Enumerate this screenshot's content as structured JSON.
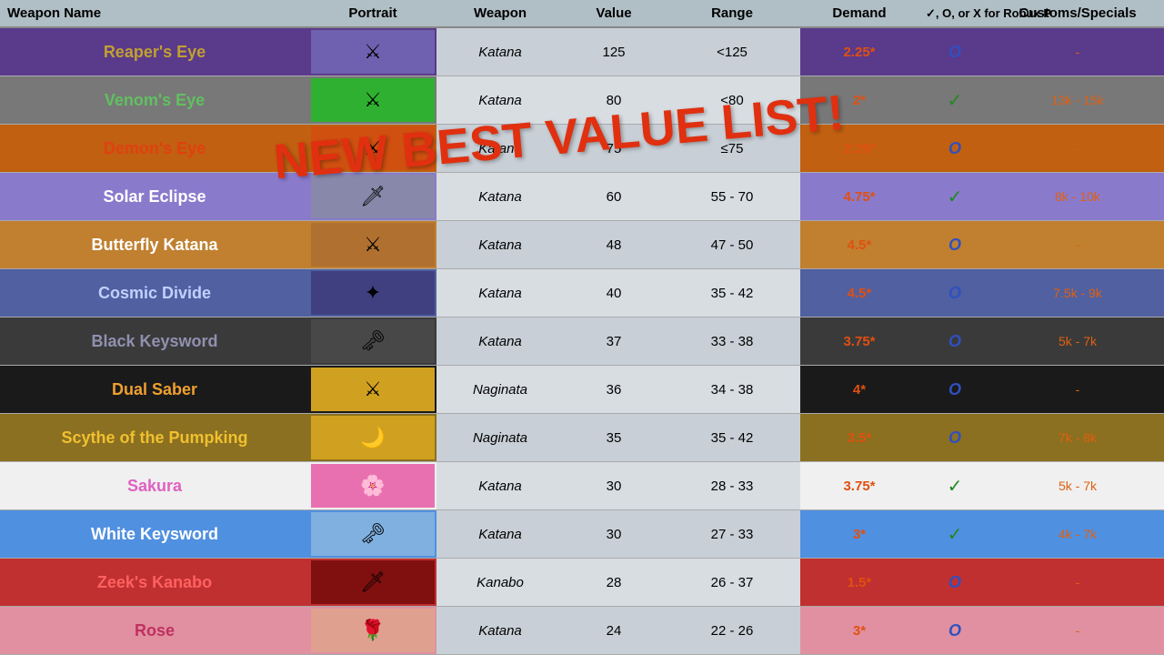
{
  "header": {
    "col_name": "Weapon Name",
    "col_portrait": "Portrait",
    "col_weapon": "Weapon",
    "col_value": "Value",
    "col_range": "Range",
    "col_demand": "Demand",
    "col_check": "✓, O, or X for Robux P",
    "col_custom": "Customs/Specials"
  },
  "overlay": "NEW BEST VALUE LIST!",
  "rows": [
    {
      "name": "Reaper's Eye",
      "name_color": "#c0a030",
      "row_class": "row-reapers-eye",
      "port_class": "port-purple",
      "port_icon": "⚔",
      "weapon": "Katana",
      "value": "125",
      "range": "<125",
      "demand": "2.25*",
      "check": "O",
      "check_type": "blue",
      "custom": "-"
    },
    {
      "name": "Venom's Eye",
      "name_color": "#60c060",
      "row_class": "row-venoms-eye",
      "port_class": "port-green",
      "port_icon": "⚔",
      "weapon": "Katana",
      "value": "80",
      "range": "<80",
      "demand": "2*",
      "check": "✓",
      "check_type": "green",
      "custom": "13k - 15k"
    },
    {
      "name": "Demon's Eye",
      "name_color": "#e04010",
      "row_class": "row-demons-eye",
      "port_class": "port-orange",
      "port_icon": "⚔",
      "weapon": "Katana",
      "value": "75",
      "range": "≤75",
      "demand": "2.25*",
      "check": "O",
      "check_type": "blue",
      "custom": "-"
    },
    {
      "name": "Solar Eclipse",
      "name_color": "#ffffff",
      "row_class": "row-solar-eclipse",
      "port_class": "port-gray",
      "port_icon": "🗡",
      "weapon": "Katana",
      "value": "60",
      "range": "55 - 70",
      "demand": "4.75*",
      "check": "✓",
      "check_type": "green",
      "custom": "8k - 10k"
    },
    {
      "name": "Butterfly Katana",
      "name_color": "#ffffff",
      "row_class": "row-butterfly",
      "port_class": "port-brown",
      "port_icon": "⚔",
      "weapon": "Katana",
      "value": "48",
      "range": "47 - 50",
      "demand": "4.5*",
      "check": "O",
      "check_type": "blue",
      "custom": "-"
    },
    {
      "name": "Cosmic Divide",
      "name_color": "#c0d0ff",
      "row_class": "row-cosmic",
      "port_class": "port-darkblue",
      "port_icon": "✦",
      "weapon": "Katana",
      "value": "40",
      "range": "35 - 42",
      "demand": "4.5*",
      "check": "O",
      "check_type": "blue",
      "custom": "7.5k - 9k"
    },
    {
      "name": "Black Keysword",
      "name_color": "#9090b0",
      "row_class": "row-black-key",
      "port_class": "port-dark",
      "port_icon": "🗝",
      "weapon": "Katana",
      "value": "37",
      "range": "33 - 38",
      "demand": "3.75*",
      "check": "O",
      "check_type": "blue",
      "custom": "5k - 7k"
    },
    {
      "name": "Dual Saber",
      "name_color": "#f0a030",
      "row_class": "row-dual-saber",
      "port_class": "port-yellow",
      "port_icon": "⚔",
      "weapon": "Naginata",
      "value": "36",
      "range": "34 - 38",
      "demand": "4*",
      "check": "O",
      "check_type": "blue",
      "custom": "-"
    },
    {
      "name": "Scythe of the Pumpking",
      "name_color": "#f0c030",
      "row_class": "row-scythe",
      "port_class": "port-yellow",
      "port_icon": "🌙",
      "weapon": "Naginata",
      "value": "35",
      "range": "35 - 42",
      "demand": "3.5*",
      "check": "O",
      "check_type": "blue",
      "custom": "7k - 8k"
    },
    {
      "name": "Sakura",
      "name_color": "#e060c0",
      "row_class": "row-sakura",
      "port_class": "port-pink",
      "port_icon": "🌸",
      "weapon": "Katana",
      "value": "30",
      "range": "28 - 33",
      "demand": "3.75*",
      "check": "✓",
      "check_type": "green",
      "custom": "5k - 7k"
    },
    {
      "name": "White Keysword",
      "name_color": "#ffffff",
      "row_class": "row-white-key",
      "port_class": "port-lightblue",
      "port_icon": "🗝",
      "weapon": "Katana",
      "value": "30",
      "range": "27 - 33",
      "demand": "3*",
      "check": "✓",
      "check_type": "green",
      "custom": "4k - 7k"
    },
    {
      "name": "Zeek's Kanabo",
      "name_color": "#ff6060",
      "row_class": "row-zeek",
      "port_class": "port-darkred",
      "port_icon": "🗡",
      "weapon": "Kanabo",
      "value": "28",
      "range": "26 - 37",
      "demand": "1.5*",
      "check": "O",
      "check_type": "blue",
      "custom": "-"
    },
    {
      "name": "Rose",
      "name_color": "#c03060",
      "row_class": "row-rose",
      "port_class": "port-salmon",
      "port_icon": "🌹",
      "weapon": "Katana",
      "value": "24",
      "range": "22 - 26",
      "demand": "3*",
      "check": "O",
      "check_type": "blue",
      "custom": "-"
    }
  ]
}
